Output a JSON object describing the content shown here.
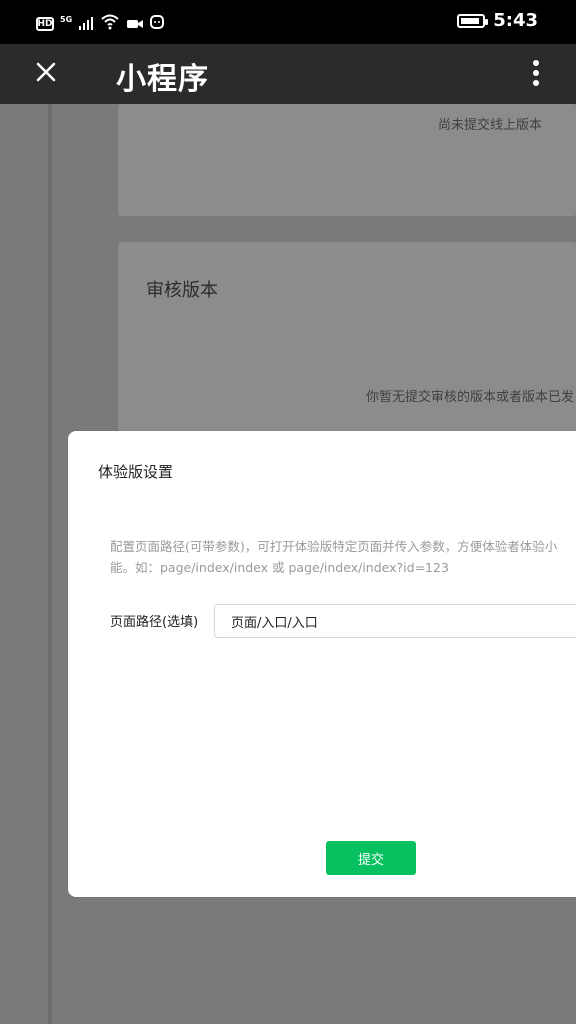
{
  "status_bar": {
    "hd": "HD",
    "network": "5G",
    "time": "5:43",
    "icons": [
      "hd-icon",
      "signal-icon",
      "wifi-icon",
      "video-icon",
      "chat-icon",
      "battery-icon"
    ]
  },
  "topbar": {
    "title": "小程序",
    "close_icon": "close-icon",
    "menu_icon": "more-vertical-icon"
  },
  "background": {
    "card1_text": "尚未提交线上版本",
    "card2_title": "审核版本",
    "card2_text": "你暂无提交审核的版本或者版本已发"
  },
  "modal": {
    "title": "体验版设置",
    "description": "配置页面路径(可带参数)，可打开体验版特定页面并传入参数，方便体验者体验小能。如：page/index/index 或 page/index/index?id=123",
    "field_label": "页面路径(选填)",
    "input_value": "页面/入口/入口",
    "submit_label": "提交"
  },
  "colors": {
    "status_bg": "#000000",
    "topbar_bg": "#2b2b2b",
    "overlay": "#7a7a7a",
    "primary": "#07c160"
  }
}
